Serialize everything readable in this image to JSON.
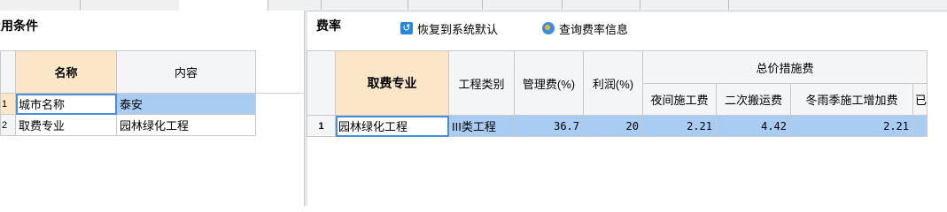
{
  "left_panel": {
    "title": "费用条件",
    "headers": {
      "name": "名称",
      "content": "内容"
    },
    "rows": [
      {
        "num": "1",
        "name": "城市名称",
        "content": "泰安"
      },
      {
        "num": "2",
        "name": "取费专业",
        "content": "园林绿化工程"
      }
    ]
  },
  "right_panel": {
    "title": "费率",
    "toolbar": {
      "restore_label": "恢复到系统默认",
      "query_label": "查询费率信息"
    },
    "headers": {
      "specialty": "取费专业",
      "category": "工程类别",
      "mgmt_fee": "管理费(%)",
      "profit": "利润(%)",
      "total_measures": "总价措施费",
      "sub": [
        "夜间施工费",
        "二次搬运费",
        "冬雨季施工增加费",
        "已"
      ]
    },
    "rows": [
      {
        "num": "1",
        "specialty": "园林绿化工程",
        "category": "III类工程",
        "mgmt_fee": "36.7",
        "profit": "20",
        "night": "2.21",
        "transport": "4.42",
        "winter": "2.21"
      }
    ]
  }
}
